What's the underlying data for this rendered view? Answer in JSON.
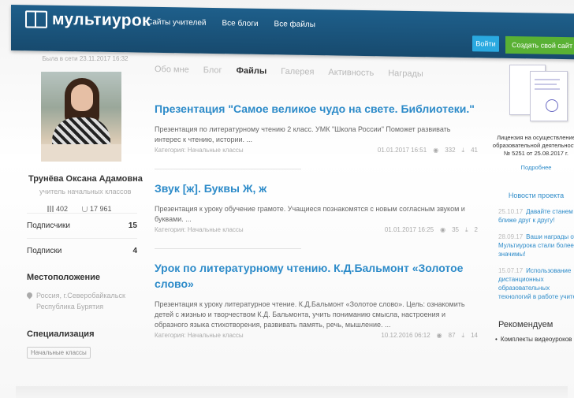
{
  "header": {
    "logo": "мультиурок",
    "nav": [
      "Сайты учителей",
      "Все блоги",
      "Все файлы"
    ],
    "login_label": "Войти",
    "create_label": "Создать свой сайт учителя"
  },
  "profile": {
    "last_seen": "Была в сети 23.11.2017 16:32",
    "name": "Трунёва Оксана Адамовна",
    "role": "учитель начальных классов",
    "stat_views": "402",
    "stat_rating": "17 961",
    "followers_label": "Подписчики",
    "followers_count": "15",
    "following_label": "Подписки",
    "following_count": "4",
    "location_title": "Местоположение",
    "location": "Россия, г.Северобайкальск Республика Бурятия",
    "spec_title": "Специализация",
    "spec_tag": "Начальные классы"
  },
  "tabs": [
    "Обо мне",
    "Блог",
    "Файлы",
    "Галерея",
    "Активность",
    "Награды"
  ],
  "articles": [
    {
      "title": "Презентация \"Самое великое чудо на свете. Библиотеки.\"",
      "text": "Презентация по литературному чтению 2 класс. УМК \"Школа России\" Поможет развивать интерес к чтению, истории. ...",
      "category": "Категория: Начальные классы",
      "date": "01.01.2017 16:51",
      "views": "332",
      "downloads": "41"
    },
    {
      "title": "Звук [ж]. Буквы Ж, ж",
      "text": "Презентация к уроку обучение грамоте. Учащиеся познакомятся с новым согласным звуком и буквами. ...",
      "category": "Категория: Начальные классы",
      "date": "01.01.2017 16:25",
      "views": "35",
      "downloads": "2"
    },
    {
      "title": "Урок по литературному чтению. К.Д.Бальмонт «Золотое слово»",
      "text": "Презентация к уроку литературное чтение. К.Д.Бальмонт «Золотое слово». Цель: ознакомить детей с жизнью и творчеством К.Д. Бальмонта, учить пониманию смысла, настроения и образного языка стихотворения, развивать память, речь, мышление. ...",
      "category": "Категория: Начальные классы",
      "date": "10.12.2016 06:12",
      "views": "87",
      "downloads": "14"
    }
  ],
  "sidebar_right": {
    "license_text": "Лицензия на осуществление образовательной деятельности № 5251 от 25.08.2017 г.",
    "more_link": "Подробнее",
    "news_title": "Новости проекта",
    "news": [
      {
        "date": "25.10.17",
        "text": "Давайте станем ближе друг к другу!"
      },
      {
        "date": "28.09.17",
        "text": "Ваши награды от Мультиурока стали более значимы!"
      },
      {
        "date": "15.07.17",
        "text": "Использование дистанционных образовательных технологий в работе учителя"
      }
    ],
    "recommend_title": "Рекомендуем",
    "recommend": [
      "Комплекты видеоуроков"
    ]
  },
  "colors": {
    "header": "#1e5f8b",
    "link": "#2d8bc9",
    "login": "#2aa9e0",
    "create": "#59b134"
  }
}
